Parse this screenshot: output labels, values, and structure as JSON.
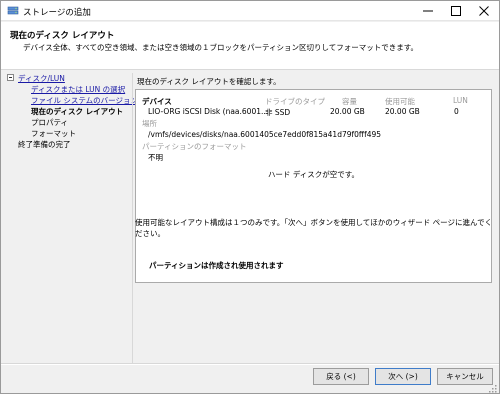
{
  "window": {
    "title": "ストレージの追加",
    "icon": "storage-wizard-icon"
  },
  "header": {
    "title": "現在のディスク レイアウト",
    "subtitle": "デバイス全体、すべての空き領域、または空き領域の１ブロックをパーティション区切りしてフォーマットできます。"
  },
  "nav": {
    "group_label": "ディスク/LUN",
    "items": [
      {
        "label": "ディスクまたは LUN の選択"
      },
      {
        "label": "ファイル システムのバージョン"
      },
      {
        "label": "現在のディスク レイアウト"
      },
      {
        "label": "プロパティ"
      },
      {
        "label": "フォーマット"
      }
    ],
    "finish_label": "終了準備の完了"
  },
  "main": {
    "instruction": "現在のディスク レイアウトを確認します。",
    "layout": {
      "headers": {
        "device": "デバイス",
        "drive_type": "ドライブのタイプ",
        "capacity": "容量",
        "available": "使用可能",
        "lun": "LUN"
      },
      "row": {
        "device": "LIO-ORG iSCSI Disk (naa.6001...",
        "drive_type": "非 SSD",
        "capacity": "20.00 GB",
        "available": "20.00 GB",
        "lun": "0"
      },
      "location_label": "場所",
      "location_value": "/vmfs/devices/disks/naa.6001405ce7edd0f815a41d79f0fff495",
      "partition_format_label": "パーティションのフォーマット",
      "partition_format_value": "不明",
      "empty_message": "ハード ディスクが空です。"
    },
    "description": "使用可能なレイアウト構成は１つのみです。「次へ」ボタンを使用してほかのウィザード ページに進んでください。",
    "partition_note": "パーティションは作成され使用されます"
  },
  "footer": {
    "back_label": "戻る (<)",
    "next_label": "次へ (>)",
    "cancel_label": "キャンセル"
  },
  "colors": {
    "link": "#1a1aa6",
    "default_button_border": "#3f7cc9"
  }
}
